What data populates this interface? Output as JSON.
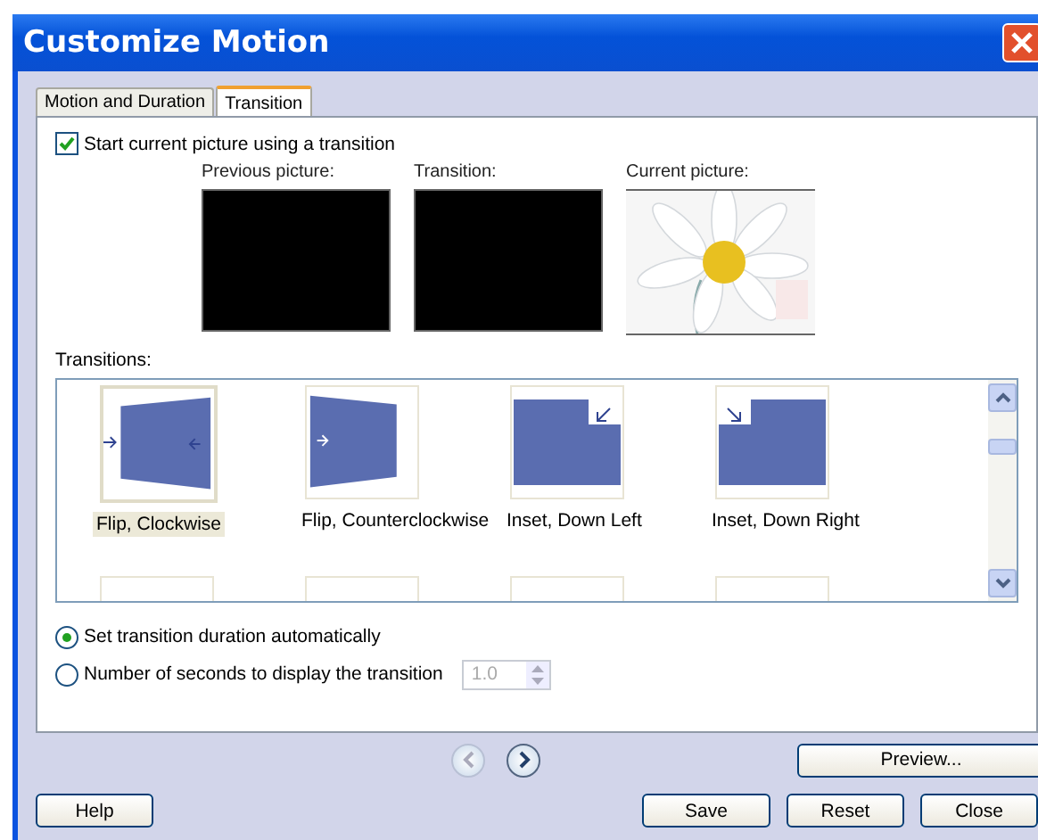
{
  "window": {
    "title": "Customize Motion"
  },
  "tabs": [
    {
      "label": "Motion and Duration",
      "selected": false
    },
    {
      "label": "Transition",
      "selected": true
    }
  ],
  "start_with_transition": {
    "label": "Start current picture using a transition",
    "checked": true
  },
  "previews": [
    {
      "label": "Previous picture:",
      "kind": "black"
    },
    {
      "label": "Transition:",
      "kind": "black"
    },
    {
      "label": "Current picture:"
    }
  ],
  "transitions": {
    "label": "Transitions:",
    "items": [
      {
        "label": "Flip, Clockwise",
        "kind": "flip-cw",
        "selected": true
      },
      {
        "label": "Flip, Counterclockwise",
        "kind": "flip-ccw",
        "selected": false
      },
      {
        "label": "Inset, Down Left",
        "kind": "inset-down-left",
        "selected": false
      },
      {
        "label": "Inset, Down Right",
        "kind": "inset-down-right",
        "selected": false
      },
      {
        "kind": "cut"
      },
      {
        "kind": "cut"
      },
      {
        "kind": "cut"
      },
      {
        "kind": "cut"
      }
    ]
  },
  "duration_options": [
    {
      "label": "Set transition duration automatically",
      "selected": true
    },
    {
      "label": "Number of seconds to display the transition",
      "selected": false
    }
  ],
  "seconds": {
    "value": "1.0",
    "disabled": true
  },
  "nav": [
    {
      "kind": "back",
      "disabled": true
    },
    {
      "kind": "forward",
      "disabled": false
    }
  ],
  "preview_button": "Preview...",
  "buttons": [
    "Help",
    "Save",
    "Reset",
    "Close"
  ]
}
